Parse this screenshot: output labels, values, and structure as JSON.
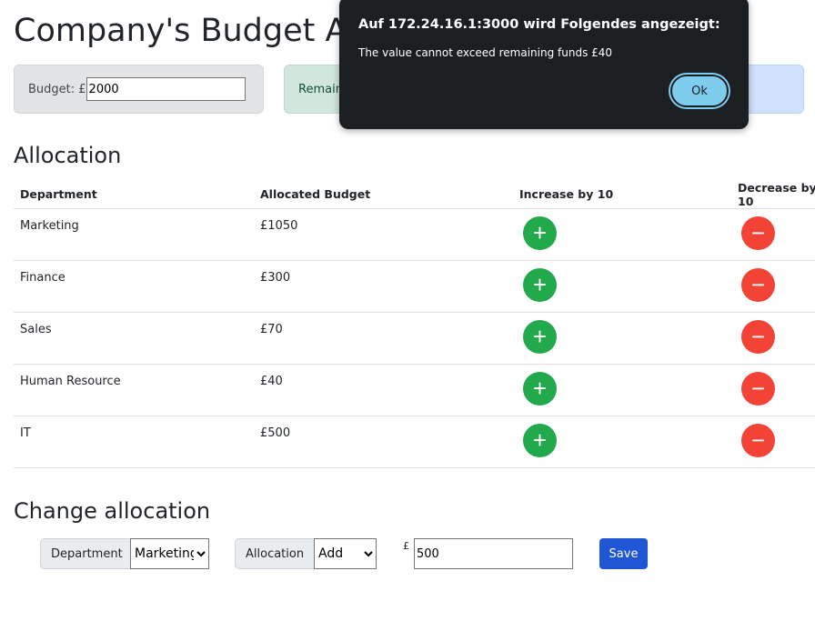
{
  "title": "Company's Budget Allocation",
  "budget": {
    "label": "Budget: £",
    "value": "2000"
  },
  "remaining": {
    "label": "Remaining"
  },
  "allocation": {
    "heading": "Allocation",
    "headers": [
      "Department",
      "Allocated Budget",
      "Increase by 10",
      "Decrease by 10"
    ],
    "rows": [
      {
        "dept": "Marketing",
        "budget": "£1050"
      },
      {
        "dept": "Finance",
        "budget": "£300"
      },
      {
        "dept": "Sales",
        "budget": "£70"
      },
      {
        "dept": "Human Resource",
        "budget": "£40"
      },
      {
        "dept": "IT",
        "budget": "£500"
      }
    ],
    "increase_symbol": "+",
    "decrease_symbol": "−"
  },
  "change": {
    "heading": "Change allocation",
    "department_label": "Department",
    "department_value": "Marketing",
    "allocation_label": "Allocation",
    "allocation_value": "Add",
    "currency": "£",
    "amount": "500",
    "save_label": "Save"
  },
  "dialog": {
    "title": "Auf 172.24.16.1:3000 wird Folgendes angezeigt:",
    "message": "The value cannot exceed remaining funds  £40",
    "ok_label": "Ok"
  },
  "colors": {
    "increase": "#22a94b",
    "decrease": "#f34336",
    "save": "#1f56d3"
  }
}
